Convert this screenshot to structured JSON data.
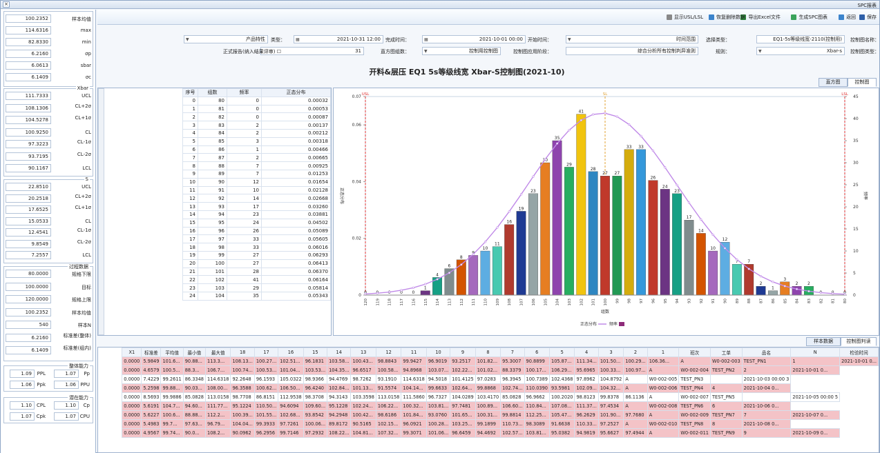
{
  "window": {
    "title": "SPC报表"
  },
  "toolbar": {
    "items": [
      {
        "label": "保存",
        "icon": "save-icon",
        "color": "#2d5fa8"
      },
      {
        "label": "返回",
        "icon": "back-icon",
        "color": "#3b84cc"
      },
      {
        "label": "生成SPC图表",
        "icon": "chart-icon",
        "color": "#3aa35b"
      },
      {
        "label": "导出Excel文件",
        "icon": "excel-icon",
        "color": "#2e8b3e"
      },
      {
        "label": "恢复删除数据",
        "icon": "restore-icon",
        "color": "#3b84cc"
      },
      {
        "label": "显示USL/LSL",
        "icon": "checkbox-icon",
        "color": "#888888"
      }
    ]
  },
  "form": {
    "chart_name_label": "控制图名称：",
    "chart_name": "EQ1-5s等级线宽-2110(控制用)",
    "select_type_label": "选择类型：",
    "select_type": "时间范围",
    "start_label": "开始时间：",
    "start": "2021-10-01 00:00",
    "end_label": "完成时间：",
    "end": "2021-10-31 12:00",
    "kind_label": "类型：",
    "kind": "产品特性",
    "chart_type_label": "控制图类型：",
    "chart_type": "Xbar-s",
    "rule_label": "规则：",
    "rule": "综合分析所有控制判异准则",
    "phase_label": "控制图应用阶段：",
    "phase": "控制用控制图",
    "subgroup_label": "直方图组数：",
    "subgroup": "31",
    "report_check": "正式报告(纳入结果评审)"
  },
  "chart_title": "开料&层压 EQ1 5s等级线宽 Xbar-S控制图(2021-10)",
  "tabs": {
    "control": "控制图",
    "hist": "直方图"
  },
  "bottom_tabs": {
    "rules": "控制图判读",
    "sample": "样本数据"
  },
  "left": {
    "stats": [
      {
        "label": "样本均值",
        "value": "100.2352"
      },
      {
        "label": "max",
        "value": "114.6316"
      },
      {
        "label": "min",
        "value": "82.8330"
      },
      {
        "label": "σp",
        "value": "6.2160"
      },
      {
        "label": "sbar",
        "value": "6.0613"
      },
      {
        "label": "σc",
        "value": "6.1409"
      }
    ],
    "xbar_title": "Xbar",
    "xbar": [
      {
        "label": "UCL",
        "value": "111.7333"
      },
      {
        "label": "CL+2σ",
        "value": "108.1306"
      },
      {
        "label": "CL+1σ",
        "value": "104.5278"
      },
      {
        "label": "CL",
        "value": "100.9250"
      },
      {
        "label": "CL-1σ",
        "value": "97.3223"
      },
      {
        "label": "CL-2σ",
        "value": "93.7195"
      },
      {
        "label": "LCL",
        "value": "90.1167"
      }
    ],
    "s_title": "S",
    "s": [
      {
        "label": "UCL",
        "value": "22.8510"
      },
      {
        "label": "CL+2σ",
        "value": "20.2518"
      },
      {
        "label": "CL+1σ",
        "value": "17.6525"
      },
      {
        "label": "CL",
        "value": "15.0533"
      },
      {
        "label": "CL-1σ",
        "value": "12.4541"
      },
      {
        "label": "CL-2σ",
        "value": "9.8549"
      },
      {
        "label": "LCL",
        "value": "7.2557"
      }
    ],
    "proc_title": "过程数据",
    "proc": [
      {
        "label": "规格下限",
        "value": "80.0000"
      },
      {
        "label": "目标",
        "value": "100.0000"
      },
      {
        "label": "规格上限",
        "value": "120.0000"
      },
      {
        "label": "样本均值",
        "value": "100.2352"
      },
      {
        "label": "样本N",
        "value": "540"
      },
      {
        "label": "标准差(整体)",
        "value": "6.2160"
      },
      {
        "label": "标准差(组内)",
        "value": "6.1409"
      }
    ],
    "overall_title": "整体能力",
    "overall": [
      {
        "label": "Pp",
        "value": "1.07"
      },
      {
        "label": "PPL",
        "value": "1.09"
      },
      {
        "label": "PPU",
        "value": "1.06"
      },
      {
        "label": "Ppk",
        "value": "1.06"
      }
    ],
    "potential_title": "潜在能力",
    "potential": [
      {
        "label": "Cp",
        "value": "1.10"
      },
      {
        "label": "CPL",
        "value": "1.10"
      },
      {
        "label": "CPU",
        "value": "1.07"
      },
      {
        "label": "Cpk",
        "value": "1.07"
      }
    ]
  },
  "dist": {
    "headers": [
      "序号",
      "组数",
      "频率",
      "正态分布"
    ],
    "rows": [
      [
        "0",
        "80",
        "0",
        "0.00032"
      ],
      [
        "1",
        "81",
        "0",
        "0.00053"
      ],
      [
        "2",
        "82",
        "0",
        "0.00087"
      ],
      [
        "3",
        "83",
        "2",
        "0.00137"
      ],
      [
        "4",
        "84",
        "2",
        "0.00212"
      ],
      [
        "5",
        "85",
        "3",
        "0.00318"
      ],
      [
        "6",
        "86",
        "1",
        "0.00466"
      ],
      [
        "7",
        "87",
        "2",
        "0.00665"
      ],
      [
        "8",
        "88",
        "7",
        "0.00925"
      ],
      [
        "9",
        "89",
        "7",
        "0.01253"
      ],
      [
        "10",
        "90",
        "12",
        "0.01654"
      ],
      [
        "11",
        "91",
        "10",
        "0.02128"
      ],
      [
        "12",
        "92",
        "14",
        "0.02668"
      ],
      [
        "13",
        "93",
        "17",
        "0.03260"
      ],
      [
        "14",
        "94",
        "23",
        "0.03881"
      ],
      [
        "15",
        "95",
        "24",
        "0.04502"
      ],
      [
        "16",
        "96",
        "26",
        "0.05089"
      ],
      [
        "17",
        "97",
        "33",
        "0.05605"
      ],
      [
        "18",
        "98",
        "33",
        "0.06016"
      ],
      [
        "19",
        "99",
        "27",
        "0.06293"
      ],
      [
        "20",
        "100",
        "27",
        "0.06413"
      ],
      [
        "21",
        "101",
        "28",
        "0.06370"
      ],
      [
        "22",
        "102",
        "41",
        "0.06164"
      ],
      [
        "23",
        "103",
        "29",
        "0.05814"
      ],
      [
        "24",
        "104",
        "35",
        "0.05343"
      ]
    ]
  },
  "grid": {
    "headers": [
      "检验时间",
      "N",
      "品名",
      "工单",
      "班次",
      "1",
      "2",
      "3",
      "4",
      "5",
      "6",
      "7",
      "8",
      "9",
      "10",
      "11",
      "12",
      "13",
      "14",
      "15",
      "16",
      "17",
      "18",
      "最大值",
      "最小值",
      "平均值",
      "标准差",
      "X1"
    ],
    "rows": [
      {
        "pink": true,
        "c": [
          "2021-10-01 0...",
          "1",
          "TEST_PN1",
          "W0-002-003",
          "A",
          "106.36...",
          "100.29...",
          "101.50...",
          "111.34...",
          "105.87...",
          "90.8899",
          "95.3007",
          "101.82...",
          "93.2517",
          "96.9019",
          "99.9427",
          "98.8843",
          "100.43...",
          "103.58...",
          "96.1831",
          "102.51...",
          "100.27...",
          "108.13...",
          "113.3...",
          "90.88...",
          "101.6...",
          "5.9849",
          "0.0000"
        ]
      },
      {
        "pink": true,
        "c": [
          "2021-10-01 0...",
          "2",
          "TEST_PN2",
          "W0-002-004",
          "A",
          "100.97...",
          "100.33...",
          "95.6965",
          "106.29...",
          "100.17...",
          "88.3379",
          "101.02...",
          "102.22...",
          "103.07...",
          "94.8968",
          "100.58...",
          "96.6517",
          "104.35...",
          "103.53...",
          "101.04...",
          "100.53...",
          "100.74...",
          "106.7...",
          "88.3...",
          "100.5...",
          "4.6579",
          "0.0000"
        ]
      },
      {
        "pink": false,
        "c": [
          "2021-10-03 00:00 3",
          "",
          "TEST_PN3",
          "W0-002-005",
          "A",
          "104.8792",
          "97.8962",
          "102.4368",
          "100.7389",
          "96.3945",
          "97.0283",
          "101.4125",
          "94.5018",
          "114.6318",
          "93.1910",
          "98.7262",
          "94.4769",
          "98.9366",
          "105.0322",
          "96.1593",
          "92.2648",
          "114.6318",
          "86.3348",
          "99.2611",
          "7.4229",
          "0.0000"
        ]
      },
      {
        "pink": true,
        "c": [
          "2021-10-04 0...",
          "4",
          "TEST_PN4",
          "W0-002-006",
          "A",
          "104.32...",
          "102.09...",
          "93.5981",
          "110.0390",
          "102.74...",
          "99.8868",
          "102.64...",
          "99.6633",
          "104.14...",
          "91.5574",
          "101.13...",
          "102.84...",
          "96.4240",
          "106.50...",
          "100.62...",
          "96.3588",
          "108.00...",
          "90.03...",
          "99.88...",
          "5.2598",
          "0.0000"
        ]
      },
      {
        "pink": false,
        "c": [
          "2021-10-05 00:00 5",
          "",
          "TEST_PN5",
          "W0-002-007",
          "A",
          "86.1136",
          "99.8378",
          "98.8123",
          "100.2020",
          "96.9662",
          "85.0828",
          "103.4170",
          "104.0289",
          "96.7327",
          "111.5860",
          "113.0158",
          "103.3598",
          "94.3143",
          "98.3708",
          "112.9538",
          "86.8151",
          "98.7708",
          "113.0158",
          "85.0828",
          "99.9886",
          "8.5693",
          "0.0000"
        ]
      },
      {
        "pink": true,
        "c": [
          "2021-10-06 0...",
          "6",
          "TEST_PN6",
          "W0-002-008",
          "A",
          "97.4534",
          "111.37...",
          "107.08...",
          "110.84...",
          "106.60...",
          "100.89...",
          "97.7481",
          "103.81...",
          "100.32...",
          "106.22...",
          "102.24...",
          "95.1228",
          "109.60...",
          "94.6094",
          "110.50...",
          "95.1224",
          "111.77...",
          "94.60...",
          "104.7...",
          "5.6191",
          "0.0000"
        ]
      },
      {
        "pink": true,
        "c": [
          "2021-10-07 0...",
          "7",
          "TEST_PN7",
          "W0-002-009",
          "A",
          "97.7680",
          "101.90...",
          "96.2629",
          "105.47...",
          "112.25...",
          "99.8814",
          "100.31...",
          "101.65...",
          "93.0760",
          "101.84...",
          "98.6186",
          "100.42...",
          "94.2948",
          "93.8542",
          "102.68...",
          "101.55...",
          "100.39...",
          "112.2...",
          "88.88...",
          "100.6...",
          "5.6227",
          "0.0000"
        ]
      },
      {
        "pink": true,
        "c": [
          "2021-10-08 0...",
          "8",
          "TEST_PN8",
          "W0-002-010",
          "A",
          "97.2527",
          "110.33...",
          "91.6638",
          "98.3089",
          "110.73...",
          "99.1899",
          "103.25...",
          "100.28...",
          "96.0921",
          "102.15...",
          "90.5165",
          "89.8172",
          "100.06...",
          "97.7261",
          "99.3933",
          "104.04...",
          "96.79...",
          "97.63...",
          "99.7...",
          "5.4983",
          "0.0000"
        ]
      },
      {
        "pink": true,
        "c": [
          "2021-10-09 0...",
          "9",
          "TEST_PN9",
          "W0-002-011",
          "A",
          "97.4944",
          "95.6627",
          "94.9819",
          "95.0382",
          "103.81...",
          "102.57...",
          "94.4692",
          "96.6459",
          "101.06...",
          "99.3071",
          "107.32...",
          "104.81...",
          "108.22...",
          "97.2932",
          "99.7146",
          "96.2956",
          "90.0962",
          "108.2...",
          "90.0...",
          "99.74...",
          "4.9567",
          "0.0000"
        ]
      }
    ]
  },
  "chart_data": {
    "type": "bar",
    "title": "",
    "xlabel": "组数",
    "ylabel": "频率",
    "y2label": "正态分布",
    "categories": [
      80,
      81,
      82,
      83,
      84,
      85,
      86,
      87,
      88,
      89,
      90,
      91,
      92,
      93,
      94,
      95,
      96,
      97,
      98,
      99,
      100,
      101,
      102,
      103,
      104,
      105,
      106,
      107,
      108,
      109,
      110,
      111,
      112,
      113,
      114,
      115,
      116,
      117,
      118,
      119,
      120
    ],
    "series": [
      {
        "name": "频率",
        "values": [
          0,
          0,
          0,
          2,
          2,
          3,
          1,
          2,
          7,
          7,
          12,
          10,
          14,
          17,
          23,
          24,
          26,
          33,
          33,
          27,
          27,
          28,
          41,
          29,
          35,
          30,
          23,
          19,
          16,
          11,
          10,
          9,
          8,
          6,
          4,
          1,
          0,
          0,
          0,
          0,
          0
        ]
      },
      {
        "name": "正态分布",
        "values": [
          0.00032,
          0.00053,
          0.00087,
          0.00137,
          0.00212,
          0.00318,
          0.00466,
          0.00665,
          0.00925,
          0.01253,
          0.01654,
          0.02128,
          0.02668,
          0.0326,
          0.03881,
          0.04502,
          0.05089,
          0.05605,
          0.06016,
          0.06293,
          0.06413,
          0.0637,
          0.06164,
          0.05814,
          0.05343,
          0.04786,
          0.04177,
          0.03553,
          0.02946,
          0.02381,
          0.01876,
          0.0144,
          0.01077,
          0.00785,
          0.00558,
          0.00386,
          0.0026,
          0.00171,
          0.00109,
          0.00068,
          0.00041
        ]
      }
    ],
    "ylim": [
      0,
      45
    ],
    "y2lim": [
      0,
      0.07
    ],
    "yticks": [
      "0",
      "5",
      "10",
      "15",
      "20",
      "25",
      "30",
      "35",
      "40",
      "45"
    ],
    "y2ticks": [
      "0",
      "0.02",
      "0.04",
      "0.06",
      "0.07"
    ],
    "ref_lines": [
      {
        "label": "LSL",
        "x": 80,
        "color": "#e03030"
      },
      {
        "label": "SL",
        "x": 100,
        "color": "#e0a030"
      },
      {
        "label": "USL",
        "x": 120,
        "color": "#e03030"
      }
    ],
    "bar_colors": [
      "#c0392b",
      "#2e86c1",
      "#f1c40f",
      "#27ae60",
      "#8e44ad",
      "#e67e22",
      "#95a5a6",
      "#1f3a93",
      "#b03a2e",
      "#48c9b0",
      "#5dade2",
      "#a569bd",
      "#d35400",
      "#7f8c8d",
      "#16a085",
      "#6c3483",
      "#c0392b",
      "#3498db",
      "#d4ac0d",
      "#229954"
    ],
    "curve_color": "#c08ae8",
    "legend_placement": "bottom"
  }
}
